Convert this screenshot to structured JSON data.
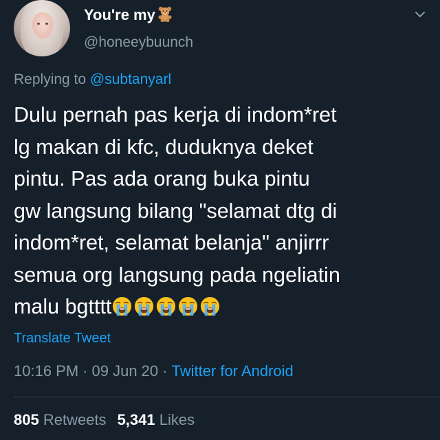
{
  "author": {
    "display_name": "You're my",
    "name_emoji": "teddy-bear-icon",
    "handle": "@honeeybuunch"
  },
  "reply": {
    "prefix": "Replying to ",
    "mention": "@subtanyarl"
  },
  "tweet": {
    "lines": [
      "Dulu pernah pas kerja di indom*ret",
      "lg makan di kfc, duduknya deket",
      "pintu. Pas ada orang buka pintu",
      "gw langsung bilang \"selamat dtg di",
      "indom*ret, selamat belanja\" anjirrr",
      "semua org langsung pada ngeliatin",
      "malu bgtttt"
    ],
    "trailing_emojis": [
      "loudly-crying-face-icon",
      "loudly-crying-face-icon",
      "loudly-crying-face-icon",
      "loudly-crying-face-icon",
      "loudly-crying-face-icon"
    ]
  },
  "translate_label": "Translate Tweet",
  "meta": {
    "time": "10:16 PM",
    "separator": "·",
    "date": "09 Jun 20",
    "source": "Twitter for Android"
  },
  "stats": {
    "retweets_count": "805",
    "retweets_label": "Retweets",
    "likes_count": "5,341",
    "likes_label": "Likes"
  },
  "colors": {
    "background": "#15202b",
    "accent": "#1da1f2",
    "secondary_text": "#8b98a5",
    "divider": "#38444d"
  }
}
